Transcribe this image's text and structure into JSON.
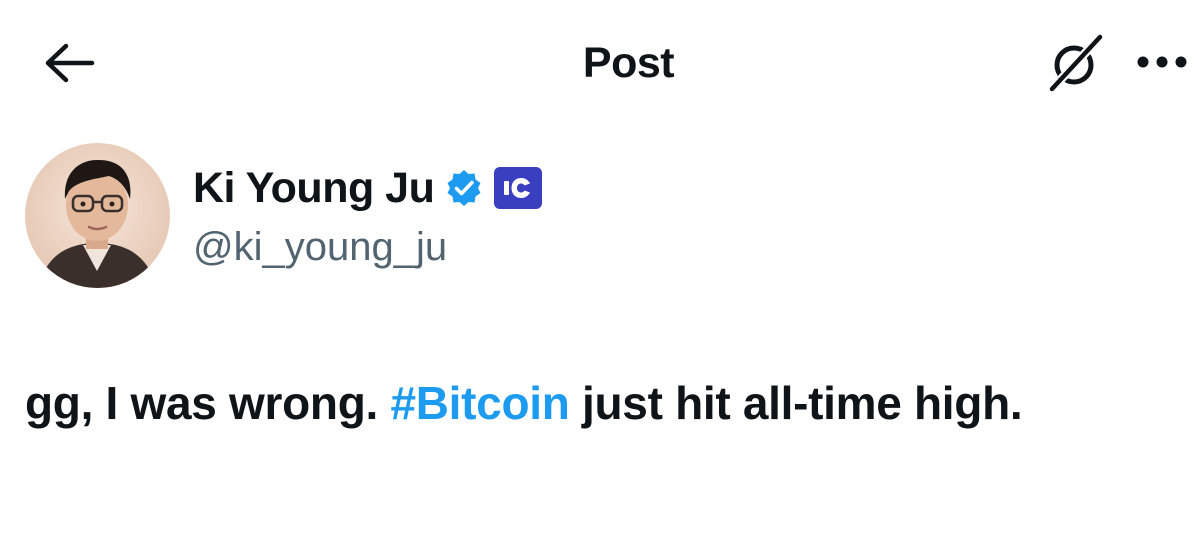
{
  "header": {
    "back_icon": "arrow-left-icon",
    "title": "Post",
    "grok_icon": "grok-icon",
    "more_icon": "more-horizontal-icon"
  },
  "author": {
    "name": "Ki Young Ju",
    "handle": "@ki_young_ju",
    "verified_icon": "verified-badge-icon",
    "affiliate_icon": "cryptoquant-affiliate-icon",
    "avatar_icon": "user-avatar",
    "colors": {
      "verified": "#1d9bf0",
      "affiliate": "#3a3fbf",
      "handle": "#536471"
    }
  },
  "post": {
    "text_before": "gg, I was wrong. ",
    "hashtag": "#Bitcoin",
    "text_after": " just hit all-time high.",
    "colors": {
      "text": "#0f1419",
      "hashtag": "#1d9bf0"
    }
  }
}
